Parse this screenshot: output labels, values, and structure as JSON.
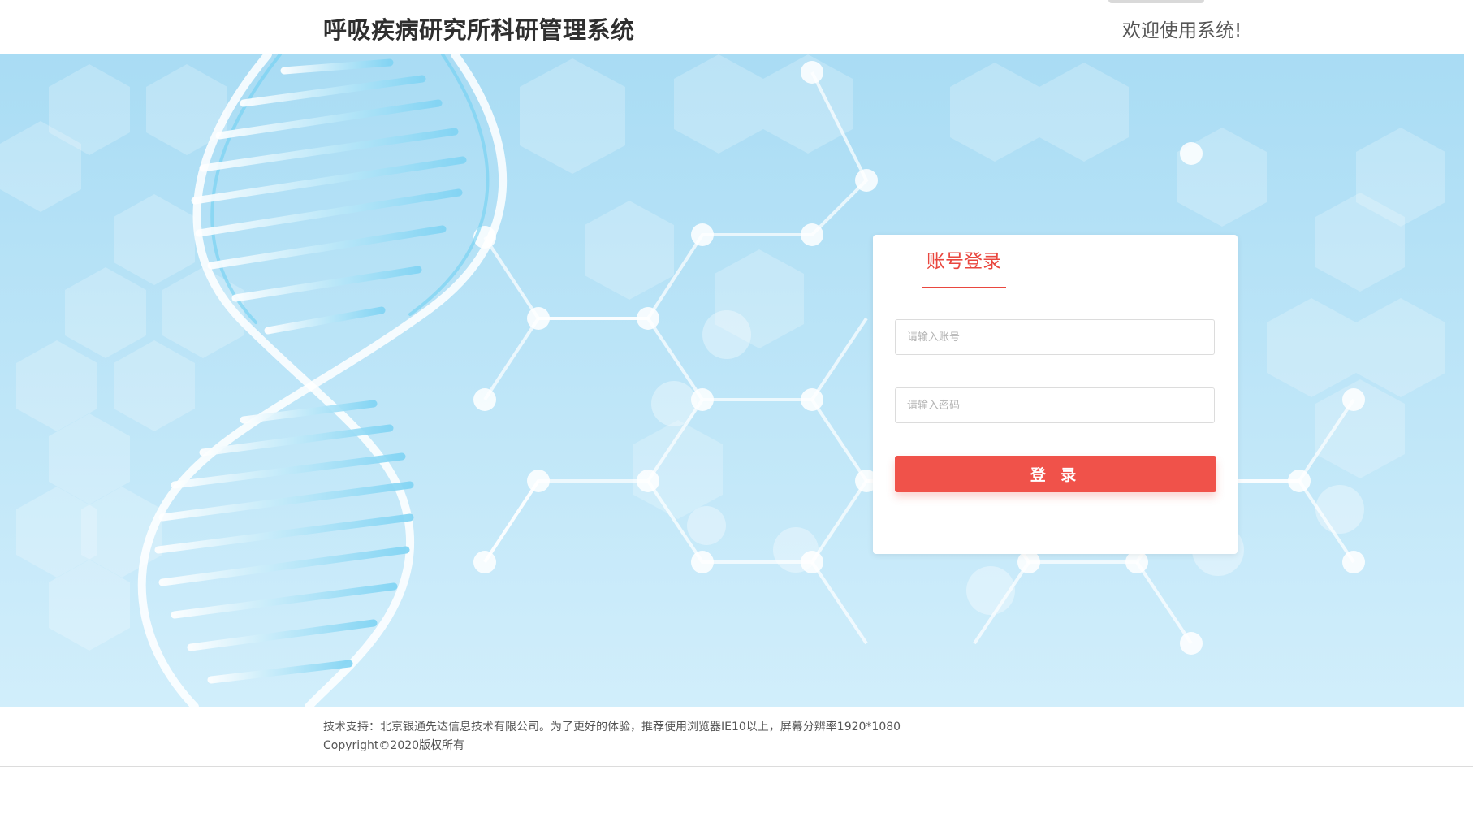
{
  "header": {
    "title": "呼吸疾病研究所科研管理系统",
    "welcome": "欢迎使用系统!"
  },
  "login": {
    "tab_label": "账号登录",
    "account_placeholder": "请输入账号",
    "password_placeholder": "请输入密码",
    "submit_label": "登 录"
  },
  "footer": {
    "support_text": "技术支持：北京银通先达信息技术有限公司。为了更好的体验，推荐使用浏览器IE10以上，屏幕分辨率1920*1080",
    "copyright": "Copyright©2020版权所有"
  },
  "colors": {
    "accent": "#e9473f",
    "button": "#f0524a",
    "banner_top": "#a9dcf4",
    "banner_bottom": "#d1eefb"
  },
  "icons": {
    "banner_art": "dna-helix-molecule-graphic"
  }
}
